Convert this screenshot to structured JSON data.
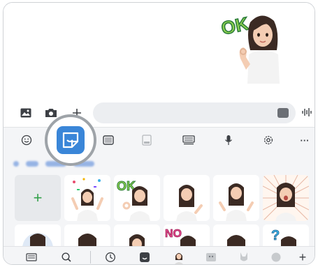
{
  "chat": {
    "sent_sticker_text": "OK",
    "sticker_caption": ""
  },
  "compose": {
    "gallery_icon": "image-icon",
    "camera_icon": "camera-icon",
    "add_icon": "plus-icon",
    "message_placeholder": "",
    "sticker_icon": "sticker-icon",
    "voice_icon": "voice-waveform-icon"
  },
  "keyboard": {
    "toolbar": [
      {
        "name": "emoji",
        "icon": "smiley-icon"
      },
      {
        "name": "stickers",
        "icon": "sticker-icon",
        "selected": true
      },
      {
        "name": "clipboard",
        "icon": "square-icon"
      },
      {
        "name": "gif",
        "icon": "gif-icon"
      },
      {
        "name": "keyboard",
        "icon": "keyboard-icon"
      },
      {
        "name": "voice",
        "icon": "mic-icon"
      },
      {
        "name": "settings",
        "icon": "gear-icon"
      },
      {
        "name": "more",
        "icon": "more-icon",
        "label": "···"
      }
    ],
    "sticker_add_label": "+",
    "sticker_ok_text": "OK",
    "sticker_no_text": "NO",
    "sticker_question_text": "?",
    "bottom_bar": {
      "add_label": "+"
    }
  },
  "colors": {
    "accent": "#3a86d8",
    "add_green": "#33a14a",
    "field_bg": "#eceef1",
    "keyboard_bg": "#f4f5f7",
    "avatar_hair": "#3b2a23",
    "avatar_shirt": "#f3f3f3"
  }
}
